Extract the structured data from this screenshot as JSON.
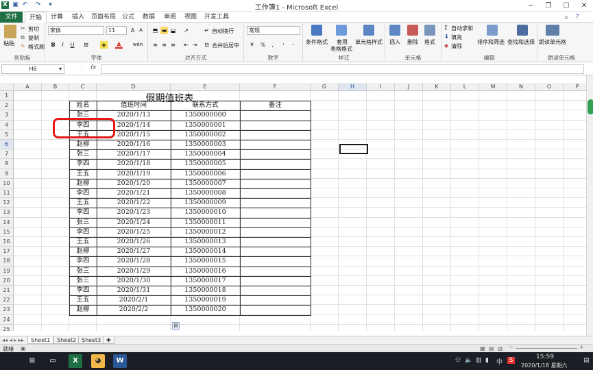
{
  "window": {
    "title": "工作簿1 - Microsoft Excel"
  },
  "tabs": [
    "文件",
    "开始",
    "计算",
    "插入",
    "页面布局",
    "公式",
    "数据",
    "审阅",
    "视图",
    "开发工具"
  ],
  "ribbon": {
    "clipboard": {
      "paste": "粘贴",
      "cut": "剪切",
      "copy": "复制",
      "format_painter": "格式刷",
      "label": "剪贴板"
    },
    "font": {
      "name": "宋体",
      "size": "11",
      "bold": "B",
      "italic": "I",
      "underline": "U",
      "label": "字体",
      "font_color_glyph": "A",
      "phonetic_glyph": "wén"
    },
    "align": {
      "wrap": "自动换行",
      "merge": "合并后居中",
      "label": "对齐方式"
    },
    "number": {
      "format": "常规",
      "label": "数字"
    },
    "styles": {
      "cond": "条件格式",
      "table1": "套用",
      "table2": "表格格式",
      "cellstyle": "单元格样式",
      "label": "样式"
    },
    "cells": {
      "insert": "插入",
      "delete": "删除",
      "format": "格式",
      "label": "单元格"
    },
    "edit": {
      "autosum": "自动求和",
      "fill": "填充",
      "clear": "清除",
      "sort": "排序和筛选",
      "find": "查找和选择",
      "label": "编辑"
    },
    "read": {
      "cell": "朗读单元格",
      "label": "朗读单元格"
    }
  },
  "formula_bar": {
    "name_box": "H6",
    "fx": "fx"
  },
  "columns": [
    "A",
    "B",
    "C",
    "D",
    "E",
    "F",
    "G",
    "H",
    "I",
    "J",
    "K",
    "L",
    "M",
    "N",
    "O",
    "P"
  ],
  "rows": [
    "1",
    "2",
    "3",
    "4",
    "5",
    "6",
    "7",
    "8",
    "9",
    "10",
    "11",
    "12",
    "13",
    "14",
    "15",
    "16",
    "17",
    "18",
    "19",
    "20",
    "21",
    "22",
    "23",
    "24",
    "25"
  ],
  "sheet": {
    "title": "假期值班表",
    "headers": [
      "姓名",
      "值班时间",
      "联系方式",
      "备注"
    ],
    "records": [
      [
        "张三",
        "2020/1/13",
        "1350000000"
      ],
      [
        "李四",
        "2020/1/14",
        "1350000001"
      ],
      [
        "王五",
        "2020/1/15",
        "1350000002"
      ],
      [
        "赵柳",
        "2020/1/16",
        "1350000003"
      ],
      [
        "张三",
        "2020/1/17",
        "1350000004"
      ],
      [
        "李四",
        "2020/1/18",
        "1350000005"
      ],
      [
        "王五",
        "2020/1/19",
        "1350000006"
      ],
      [
        "赵柳",
        "2020/1/20",
        "1350000007"
      ],
      [
        "李四",
        "2020/1/21",
        "1350000008"
      ],
      [
        "王五",
        "2020/1/22",
        "1350000009"
      ],
      [
        "李四",
        "2020/1/23",
        "1350000010"
      ],
      [
        "张三",
        "2020/1/24",
        "1350000011"
      ],
      [
        "李四",
        "2020/1/25",
        "1350000012"
      ],
      [
        "王五",
        "2020/1/26",
        "1350000013"
      ],
      [
        "赵柳",
        "2020/1/27",
        "1350000014"
      ],
      [
        "李四",
        "2020/1/28",
        "1350000015"
      ],
      [
        "张三",
        "2020/1/29",
        "1350000016"
      ],
      [
        "张三",
        "2020/1/30",
        "1350000017"
      ],
      [
        "李四",
        "2020/1/31",
        "1350000018"
      ],
      [
        "王五",
        "2020/2/1",
        "1350000019"
      ],
      [
        "赵柳",
        "2020/2/2",
        "1350000020"
      ]
    ]
  },
  "sheet_tabs": [
    "Sheet1",
    "Sheet2",
    "Sheet3"
  ],
  "status": {
    "ready": "就绪"
  },
  "taskbar": {
    "time": "15:59",
    "date": "2020/1/18 星期六",
    "ime": "中"
  },
  "colors": {
    "excel_green": "#1f7145",
    "annotation_red": "#e51919",
    "taskbar": "#1b1e24"
  }
}
